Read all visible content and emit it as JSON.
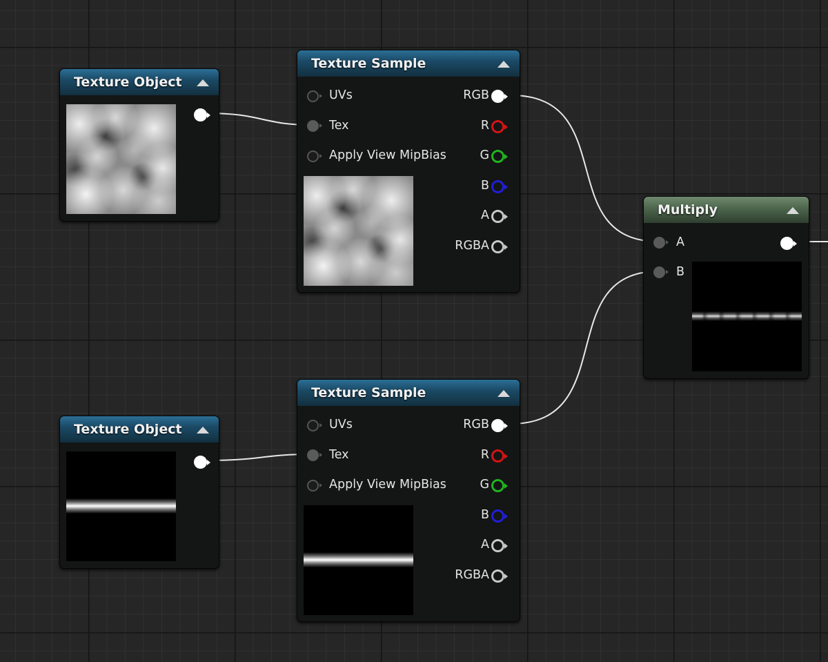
{
  "graph": {
    "nodes": {
      "texture_object_1": {
        "title": "Texture Object",
        "preview": "cloud-noise"
      },
      "texture_sample_1": {
        "title": "Texture Sample",
        "inputs": {
          "uvs": "UVs",
          "tex": "Tex",
          "mipbias": "Apply View MipBias"
        },
        "outputs": {
          "rgb": "RGB",
          "r": "R",
          "g": "G",
          "b": "B",
          "a": "A",
          "rgba": "RGBA"
        },
        "preview": "cloud-noise"
      },
      "texture_object_2": {
        "title": "Texture Object",
        "preview": "horizontal-stripe"
      },
      "texture_sample_2": {
        "title": "Texture Sample",
        "inputs": {
          "uvs": "UVs",
          "tex": "Tex",
          "mipbias": "Apply View MipBias"
        },
        "outputs": {
          "rgb": "RGB",
          "r": "R",
          "g": "G",
          "b": "B",
          "a": "A",
          "rgba": "RGBA"
        },
        "preview": "horizontal-stripe"
      },
      "multiply": {
        "title": "Multiply",
        "inputs": {
          "a": "A",
          "b": "B"
        },
        "preview": "noisy-horizontal-stripe"
      }
    },
    "connections": [
      "texture_object_1.output -> texture_sample_1.tex",
      "texture_sample_1.rgb -> multiply.a",
      "texture_object_2.output -> texture_sample_2.tex",
      "texture_sample_2.rgb -> multiply.b",
      "multiply.output -> offscreen"
    ],
    "colors": {
      "grid_background": "#262626",
      "header_texture": "#1b4a66",
      "header_math": "#4c654c",
      "pin_r": "#d41414",
      "pin_g": "#1fb61f",
      "pin_b": "#1f1fd8",
      "wire": "#e8e8e8"
    }
  }
}
